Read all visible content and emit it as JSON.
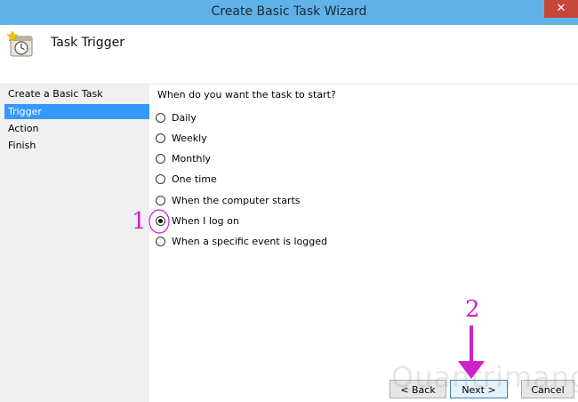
{
  "window": {
    "title": "Create Basic Task Wizard",
    "close_glyph": "✕"
  },
  "header": {
    "title": "Task Trigger",
    "icon": "task-clock-icon"
  },
  "sidebar": {
    "items": [
      {
        "label": "Create a Basic Task",
        "active": false
      },
      {
        "label": "Trigger",
        "active": true
      },
      {
        "label": "Action",
        "active": false
      },
      {
        "label": "Finish",
        "active": false
      }
    ]
  },
  "main": {
    "question": "When do you want the task to start?",
    "options": [
      {
        "label": "Daily",
        "checked": false
      },
      {
        "label": "Weekly",
        "checked": false
      },
      {
        "label": "Monthly",
        "checked": false
      },
      {
        "label": "One time",
        "checked": false
      },
      {
        "label": "When the computer starts",
        "checked": false
      },
      {
        "label": "When I log on",
        "checked": true
      },
      {
        "label": "When a specific event is logged",
        "checked": false
      }
    ]
  },
  "buttons": {
    "back": "< Back",
    "next": "Next >",
    "cancel": "Cancel"
  },
  "annotations": {
    "step1": "1",
    "step2": "2",
    "color": "#d021c8"
  },
  "watermark": "Quantrimang"
}
